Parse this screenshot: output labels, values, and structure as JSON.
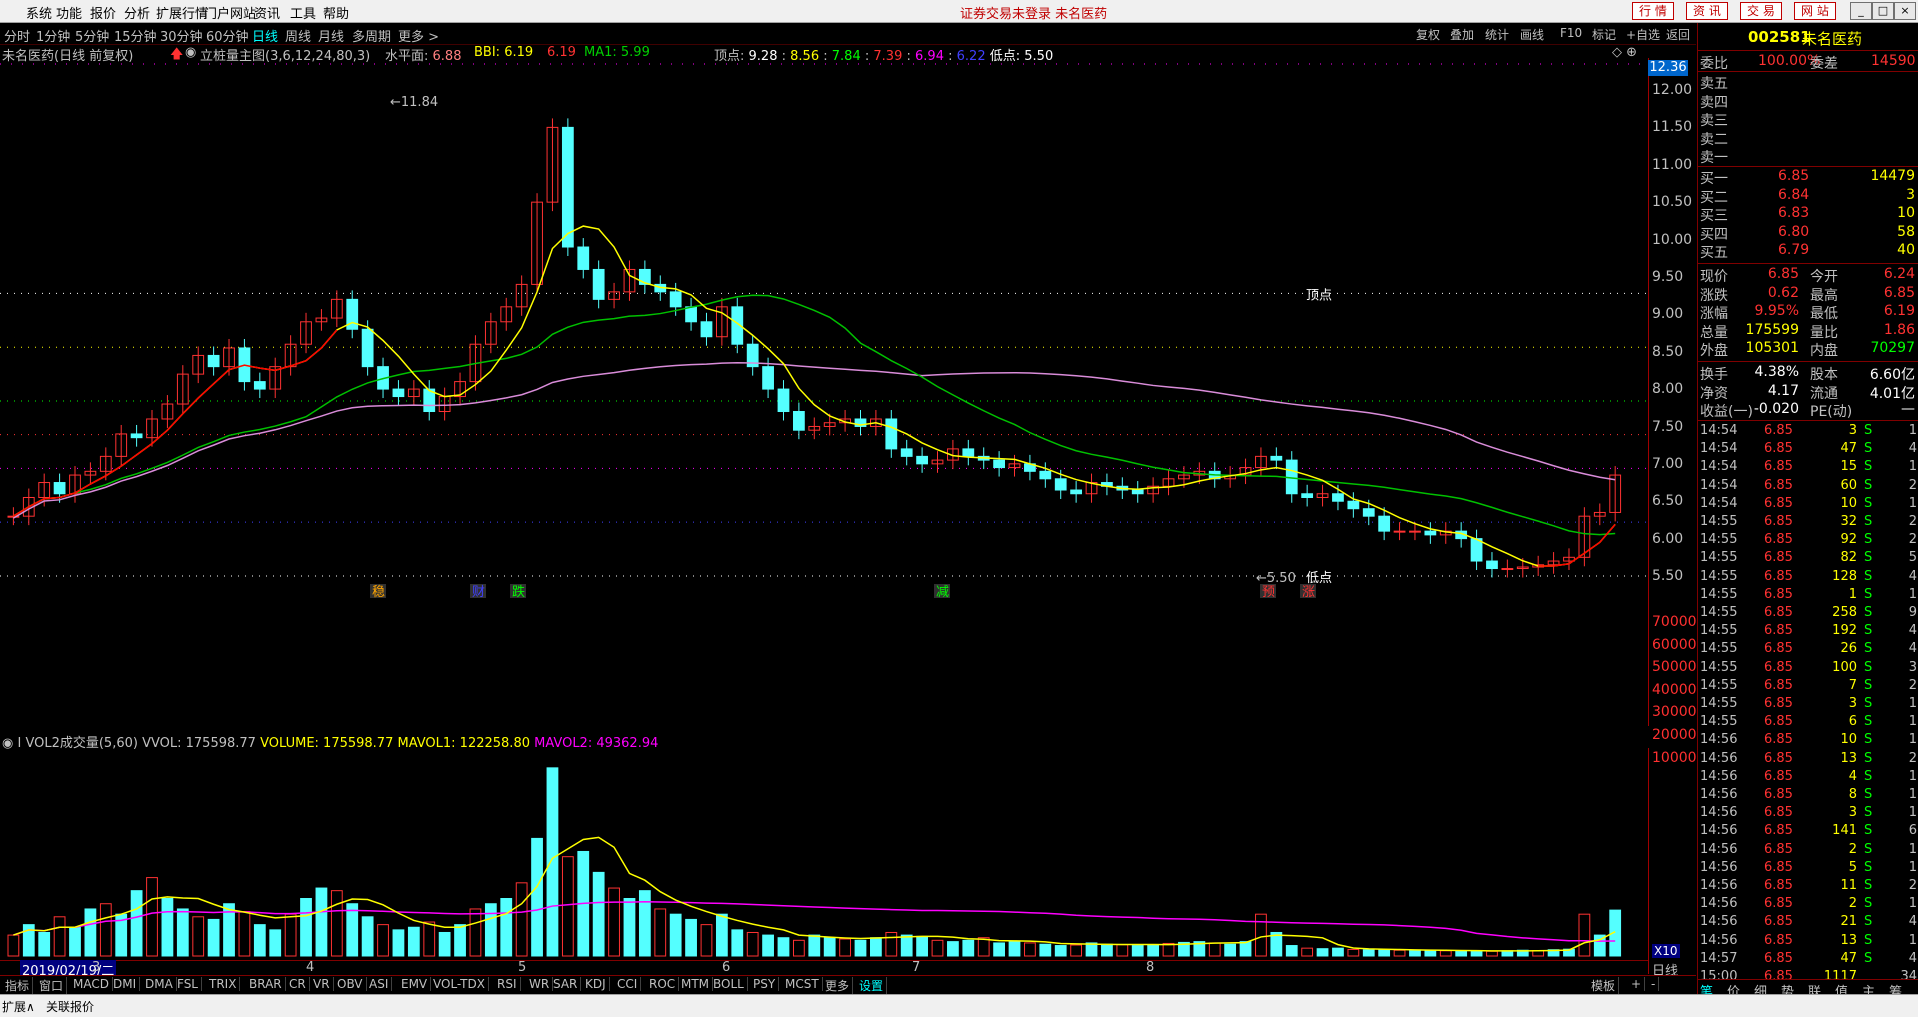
{
  "menu": {
    "items": [
      "系统",
      "功能",
      "报价",
      "分析",
      "扩展行情",
      "门户网站",
      "资讯",
      "工具",
      "帮助"
    ],
    "notice": "证券交易未登录  未名医药",
    "top_buttons": [
      "行 情",
      "资 讯",
      "交 易",
      "网 站"
    ],
    "window_buttons": [
      "_",
      "□",
      "×"
    ]
  },
  "periods": {
    "items": [
      "分时",
      "1分钟",
      "5分钟",
      "15分钟",
      "30分钟",
      "60分钟",
      "日线",
      "周线",
      "月线",
      "多周期",
      "更多 >"
    ],
    "active": "日线",
    "right_items": [
      "复权",
      "叠加",
      "统计",
      "画线",
      "F10",
      "标记",
      "+自选",
      "返回"
    ]
  },
  "chart": {
    "title_name": "未名医药",
    "title_mode": "(日线 前复权)",
    "indicator": "立桩量主图(3,6,12,24,80,3)",
    "water_label": "水平面:",
    "water_value": "6.88",
    "bbi_label": "BBI:",
    "bbi_value": "6.19",
    "bbi_value2": "6.19",
    "ma1_label": "MA1:",
    "ma1_value": "5.99",
    "top_label": "顶点:",
    "top_values": [
      "9.28",
      "8.56",
      "7.84",
      "7.39",
      "6.94",
      "6.22"
    ],
    "low_label": "低点:",
    "low_value": "5.50",
    "current_price_tag": "12.36",
    "y_axis": [
      "12.00",
      "11.50",
      "11.00",
      "10.50",
      "10.00",
      "9.50",
      "9.00",
      "8.50",
      "8.00",
      "7.50",
      "7.00",
      "6.50",
      "6.00",
      "5.50"
    ],
    "high_marker": "11.84",
    "low_marker": "5.50",
    "top_point_label": "顶点",
    "low_point_label": "低点",
    "event_marks": [
      "稳",
      "财",
      "跌",
      "减",
      "预",
      "涨"
    ]
  },
  "volume": {
    "indicator": "VOL2成交量(5,60)",
    "vvol": "VVOL: 175598.77",
    "volume": "VOLUME: 175598.77",
    "mavol1": "MAVOL1: 122258.80",
    "mavol2": "MAVOL2: 49362.94",
    "y_axis": [
      "70000",
      "60000",
      "50000",
      "40000",
      "30000",
      "20000",
      "10000"
    ],
    "unit": "X10",
    "date_tag": "2019/02/19/二",
    "months": [
      "3",
      "4",
      "5",
      "6",
      "7",
      "8"
    ],
    "period_label": "日线"
  },
  "indicator_tabs": [
    "指标",
    "窗口",
    "MACD",
    "DMI",
    "DMA",
    "FSL",
    "TRIX",
    "BRAR",
    "CR",
    "VR",
    "OBV",
    "ASI",
    "EMV",
    "VOL-TDX",
    "RSI",
    "WR",
    "SAR",
    "KDJ",
    "CCI",
    "ROC",
    "MTM",
    "BOLL",
    "PSY",
    "MCST",
    "更多",
    "设置"
  ],
  "tabs_right": [
    "模板",
    "+",
    "-"
  ],
  "statusbar": {
    "items": [
      "扩展∧",
      "关联报价"
    ]
  },
  "quote": {
    "code": "002581",
    "name": "未名医药",
    "weibi_label": "委比",
    "weibi_value": "100.00%",
    "weicha_label": "委差",
    "weicha_value": "14590",
    "sells": [
      {
        "label": "卖五",
        "price": "",
        "vol": ""
      },
      {
        "label": "卖四",
        "price": "",
        "vol": ""
      },
      {
        "label": "卖三",
        "price": "",
        "vol": ""
      },
      {
        "label": "卖二",
        "price": "",
        "vol": ""
      },
      {
        "label": "卖一",
        "price": "",
        "vol": ""
      }
    ],
    "buys": [
      {
        "label": "买一",
        "price": "6.85",
        "vol": "14479"
      },
      {
        "label": "买二",
        "price": "6.84",
        "vol": "3"
      },
      {
        "label": "买三",
        "price": "6.83",
        "vol": "10"
      },
      {
        "label": "买四",
        "price": "6.80",
        "vol": "58"
      },
      {
        "label": "买五",
        "price": "6.79",
        "vol": "40"
      }
    ],
    "stats": [
      {
        "l1": "现价",
        "v1": "6.85",
        "l2": "今开",
        "v2": "6.24"
      },
      {
        "l1": "涨跌",
        "v1": "0.62",
        "l2": "最高",
        "v2": "6.85"
      },
      {
        "l1": "涨幅",
        "v1": "9.95%",
        "l2": "最低",
        "v2": "6.19"
      },
      {
        "l1": "总量",
        "v1": "175599",
        "l2": "量比",
        "v2": "1.86"
      },
      {
        "l1": "外盘",
        "v1": "105301",
        "l2": "内盘",
        "v2": "70297"
      }
    ],
    "stats2": [
      {
        "l1": "换手",
        "v1": "4.38%",
        "l2": "股本",
        "v2": "6.60亿"
      },
      {
        "l1": "净资",
        "v1": "4.17",
        "l2": "流通",
        "v2": "4.01亿"
      },
      {
        "l1": "收益(一)",
        "v1": "-0.020",
        "l2": "PE(动)",
        "v2": "—"
      }
    ],
    "ticks": [
      [
        "14:54",
        "6.85",
        "3",
        "S",
        "1"
      ],
      [
        "14:54",
        "6.85",
        "47",
        "S",
        "4"
      ],
      [
        "14:54",
        "6.85",
        "15",
        "S",
        "1"
      ],
      [
        "14:54",
        "6.85",
        "60",
        "S",
        "2"
      ],
      [
        "14:54",
        "6.85",
        "10",
        "S",
        "1"
      ],
      [
        "14:55",
        "6.85",
        "32",
        "S",
        "2"
      ],
      [
        "14:55",
        "6.85",
        "92",
        "S",
        "2"
      ],
      [
        "14:55",
        "6.85",
        "82",
        "S",
        "5"
      ],
      [
        "14:55",
        "6.85",
        "128",
        "S",
        "4"
      ],
      [
        "14:55",
        "6.85",
        "1",
        "S",
        "1"
      ],
      [
        "14:55",
        "6.85",
        "258",
        "S",
        "9"
      ],
      [
        "14:55",
        "6.85",
        "192",
        "S",
        "4"
      ],
      [
        "14:55",
        "6.85",
        "26",
        "S",
        "4"
      ],
      [
        "14:55",
        "6.85",
        "100",
        "S",
        "3"
      ],
      [
        "14:55",
        "6.85",
        "7",
        "S",
        "2"
      ],
      [
        "14:55",
        "6.85",
        "3",
        "S",
        "1"
      ],
      [
        "14:55",
        "6.85",
        "6",
        "S",
        "1"
      ],
      [
        "14:56",
        "6.85",
        "10",
        "S",
        "1"
      ],
      [
        "14:56",
        "6.85",
        "13",
        "S",
        "2"
      ],
      [
        "14:56",
        "6.85",
        "4",
        "S",
        "1"
      ],
      [
        "14:56",
        "6.85",
        "8",
        "S",
        "1"
      ],
      [
        "14:56",
        "6.85",
        "3",
        "S",
        "1"
      ],
      [
        "14:56",
        "6.85",
        "141",
        "S",
        "6"
      ],
      [
        "14:56",
        "6.85",
        "2",
        "S",
        "1"
      ],
      [
        "14:56",
        "6.85",
        "5",
        "S",
        "1"
      ],
      [
        "14:56",
        "6.85",
        "11",
        "S",
        "2"
      ],
      [
        "14:56",
        "6.85",
        "2",
        "S",
        "1"
      ],
      [
        "14:56",
        "6.85",
        "21",
        "S",
        "4"
      ],
      [
        "14:56",
        "6.85",
        "13",
        "S",
        "1"
      ],
      [
        "14:57",
        "6.85",
        "47",
        "S",
        "4"
      ],
      [
        "15:00",
        "6.85",
        "1117",
        "",
        "34"
      ]
    ],
    "bottom_tabs": [
      "笔",
      "价",
      "细",
      "势",
      "联",
      "值",
      "主",
      "筹"
    ]
  },
  "colors": {
    "up": "#ff3232",
    "down": "#54ffff",
    "ma": "#ffff00",
    "ma2": "#ff0000",
    "ma3": "#00c000",
    "ma4": "#d98cd9"
  }
}
